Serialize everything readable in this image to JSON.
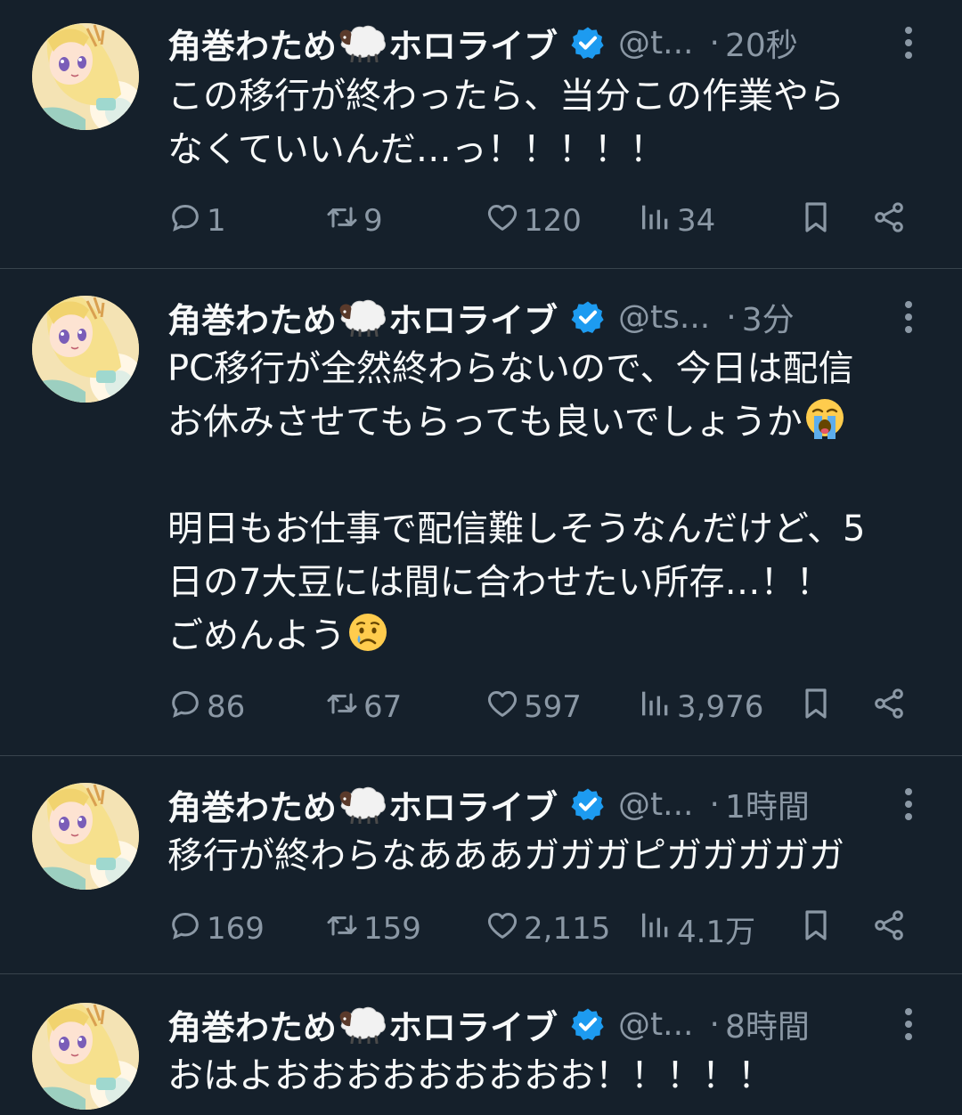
{
  "tweets": [
    {
      "name_a": "角巻わため",
      "name_b": "ホロライブ",
      "handle": "@t...",
      "dot": "·",
      "time": "20秒",
      "body_parts": [
        "この移行が終わったら、当分この作業やら\nなくていいんだ…っ！！！！！"
      ],
      "replies": "1",
      "retweets": "9",
      "likes": "120",
      "views": "34"
    },
    {
      "name_a": "角巻わため",
      "name_b": "ホロライブ",
      "handle": "@ts...",
      "dot": "·",
      "time": "3分",
      "body_parts": [
        "PC移行が全然終わらないので、今日は配信\nお休みさせてもらっても良いでしょうか",
        "\n\n明日もお仕事で配信難しそうなんだけど、5\n日の7大豆には間に合わせたい所存…！！\nごめんよう"
      ],
      "replies": "86",
      "retweets": "67",
      "likes": "597",
      "views": "3,976"
    },
    {
      "name_a": "角巻わため",
      "name_b": "ホロライブ",
      "handle": "@t...",
      "dot": "·",
      "time": "1時間",
      "body_parts": [
        "移行が終わらなあああガガガピガガガガガ"
      ],
      "replies": "169",
      "retweets": "159",
      "likes": "2,115",
      "views": "4.1万"
    },
    {
      "name_a": "角巻わため",
      "name_b": "ホロライブ",
      "handle": "@t...",
      "dot": "·",
      "time": "8時間",
      "body_parts": [
        "おはよおおおおおおおおお！！！！！"
      ]
    }
  ],
  "emojis": {
    "crying": "loudly-crying-face",
    "tear": "crying-face"
  },
  "colors": {
    "background": "#15202b",
    "text": "#f7f9f9",
    "muted": "#8b98a5",
    "verified": "#1d9bf0",
    "divider": "#38444d"
  }
}
